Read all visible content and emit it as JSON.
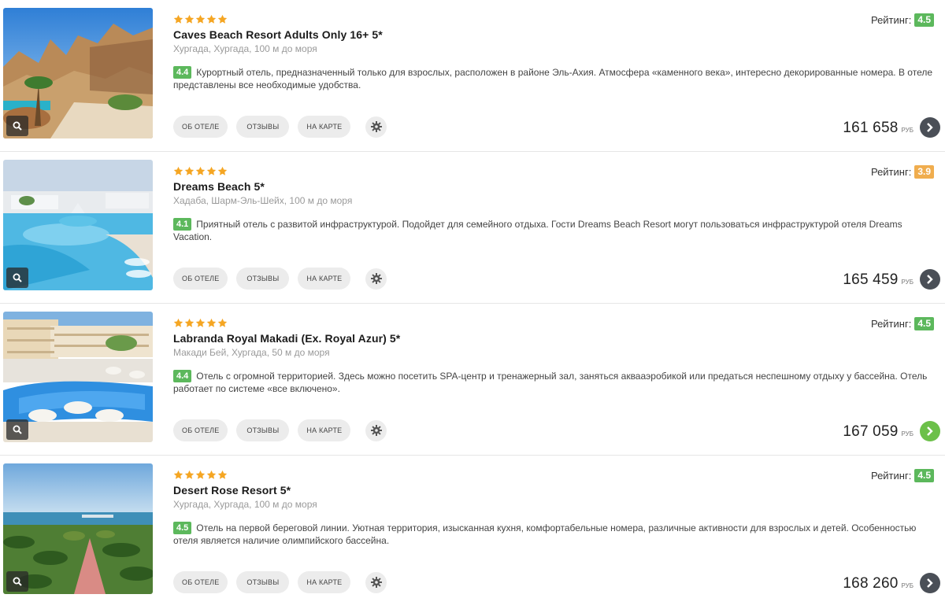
{
  "labels": {
    "rating_prefix": "Рейтинг:",
    "btn_about": "ОБ ОТЕЛЕ",
    "btn_reviews": "ОТЗЫВЫ",
    "btn_map": "НА КАРТЕ",
    "currency": "РУБ"
  },
  "colors": {
    "star": "#f5a623",
    "rating_green": "#5cb85c",
    "rating_yellow": "#f0ad4e",
    "arrow_dark": "#4a4f57",
    "arrow_green": "#6cc04a"
  },
  "icons": {
    "zoom": "search-icon",
    "settings": "gear-icon",
    "go": "chevron-right-icon",
    "stars": "star-icon"
  },
  "hotels": [
    {
      "stars": 5,
      "name": "Caves Beach Resort Adults Only 16+ 5*",
      "location": "Хургада, Хургада, 100 м до моря",
      "score": "4.4",
      "description": "Курортный отель, предназначенный только для взрослых, расположен в районе Эль-Ахия. Атмосфера «каменного века», интересно декорированные номера. В отеле представлены все необходимые удобства.",
      "rating": "4.5",
      "rating_color": "#5cb85c",
      "price": "161 658",
      "arrow_color": "#4a4f57"
    },
    {
      "stars": 5,
      "name": "Dreams Beach 5*",
      "location": "Хадаба, Шарм-Эль-Шейх, 100 м до моря",
      "score": "4.1",
      "description": "Приятный отель с развитой инфраструктурой. Подойдет для семейного отдыха. Гости Dreams Beach Resort могут пользоваться инфраструктурой отеля Dreams Vacation.",
      "rating": "3.9",
      "rating_color": "#f0ad4e",
      "price": "165 459",
      "arrow_color": "#4a4f57"
    },
    {
      "stars": 5,
      "name": "Labranda Royal Makadi (Ex. Royal Azur) 5*",
      "location": "Макади Бей, Хургада, 50 м до моря",
      "score": "4.4",
      "description": "Отель с огромной территорией. Здесь можно посетить SPA-центр и тренажерный зал, заняться аквааэробикой или предаться неспешному отдыху у бассейна. Отель работает по системе «все включено».",
      "rating": "4.5",
      "rating_color": "#5cb85c",
      "price": "167 059",
      "arrow_color": "#6cc04a"
    },
    {
      "stars": 5,
      "name": "Desert Rose Resort 5*",
      "location": "Хургада, Хургада, 100 м до моря",
      "score": "4.5",
      "description": "Отель на первой береговой линии. Уютная территория, изысканная кухня, комфортабельные номера, различные активности для взрослых и детей. Особенностью отеля является наличие олимпийского бассейна.",
      "rating": "4.5",
      "rating_color": "#5cb85c",
      "price": "168 260",
      "arrow_color": "#4a4f57"
    }
  ]
}
